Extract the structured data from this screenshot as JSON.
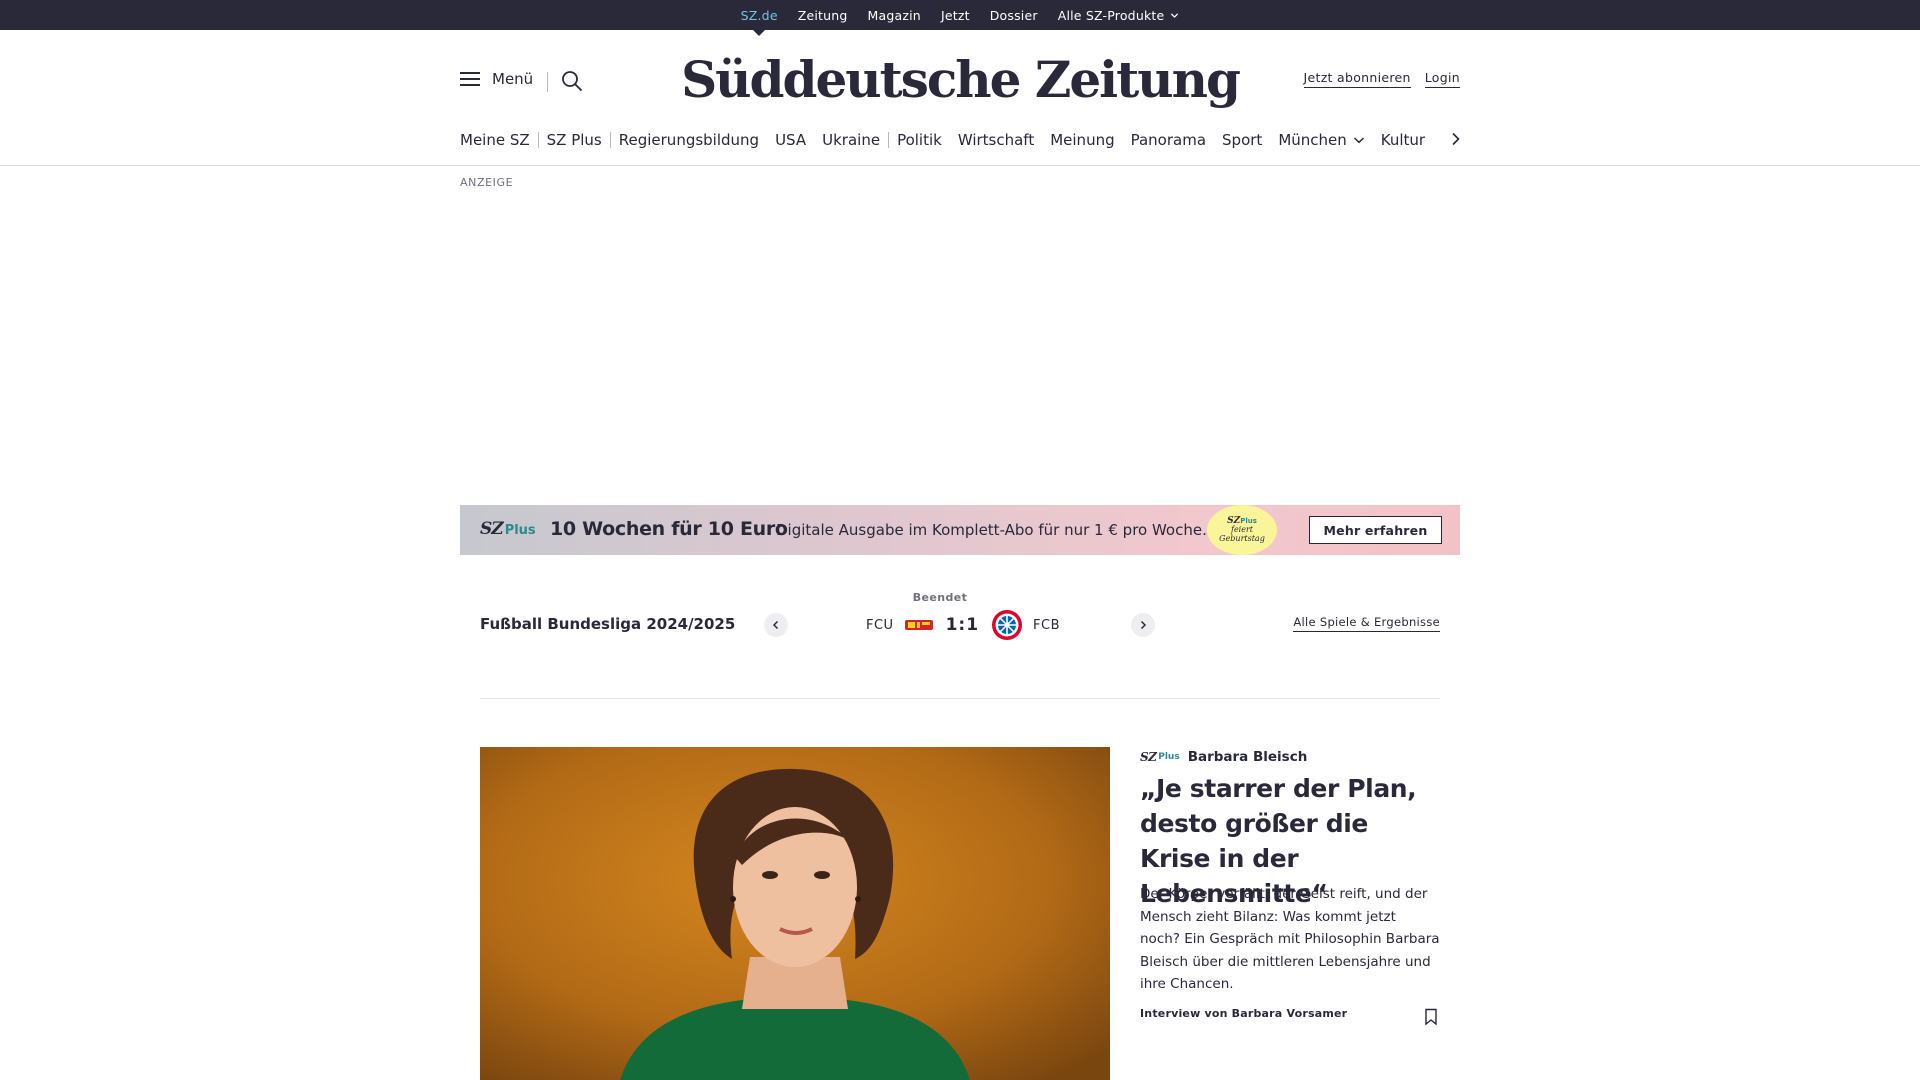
{
  "topbar": {
    "links": [
      {
        "label": "SZ.de",
        "active": true
      },
      {
        "label": "Zeitung"
      },
      {
        "label": "Magazin"
      },
      {
        "label": "Jetzt"
      },
      {
        "label": "Dossier"
      },
      {
        "label": "Alle SZ-Produkte",
        "has_dropdown": true
      }
    ]
  },
  "header": {
    "menu_label": "Menü",
    "logo_text": "Süddeutsche Zeitung",
    "subscribe_label": "Jetzt abonnieren",
    "login_label": "Login",
    "icons": {
      "menu": "hamburger-icon",
      "search": "search-icon"
    }
  },
  "section_nav": {
    "items": [
      "Meine SZ",
      "SZ Plus",
      "Regierungsbildung",
      "USA",
      "Ukraine",
      "Politik",
      "Wirtschaft",
      "Meinung",
      "Panorama",
      "Sport",
      "München",
      "Kultur"
    ],
    "dropdown_item": "München"
  },
  "ad": {
    "label": "ANZEIGE"
  },
  "promo": {
    "logo_sz": "SZ",
    "logo_plus": "Plus",
    "headline": "10 Wochen für 10 Euro",
    "text": "Digitale Ausgabe im Komplett-Abo für nur 1 € pro Woche.",
    "badge_logo": "SZ",
    "badge_plus": "Plus",
    "badge_line1": "feiert",
    "badge_line2": "Geburtstag",
    "button_label": "Mehr erfahren",
    "colors": {
      "badge": "#fbf59a",
      "plus": "#2a8b8e"
    }
  },
  "ticker": {
    "league": "Fußball Bundesliga 2024/2025",
    "status": "Beendet",
    "home_team": "FCU",
    "away_team": "FCB",
    "score": "1:1",
    "all_games_label": "Alle Spiele & Ergebnisse"
  },
  "teaser": {
    "meta_sz": "SZ",
    "meta_plus": "Plus",
    "kicker": "Barbara Bleisch",
    "title": "„Je starrer der Plan, desto größer die Krise in der Lebensmitte“",
    "summary": "Der Körper verfällt, der Geist reift, und der Mensch zieht Bilanz: Was kommt jetzt noch? Ein Gespräch mit Philosophin Barbara Bleisch über die mittleren Lebensjahre und ihre Chancen.",
    "author": "Interview von Barbara Vorsamer"
  },
  "colors": {
    "ink": "#29293a",
    "accent": "#71c5e8",
    "topbar_bg": "#29293a"
  }
}
